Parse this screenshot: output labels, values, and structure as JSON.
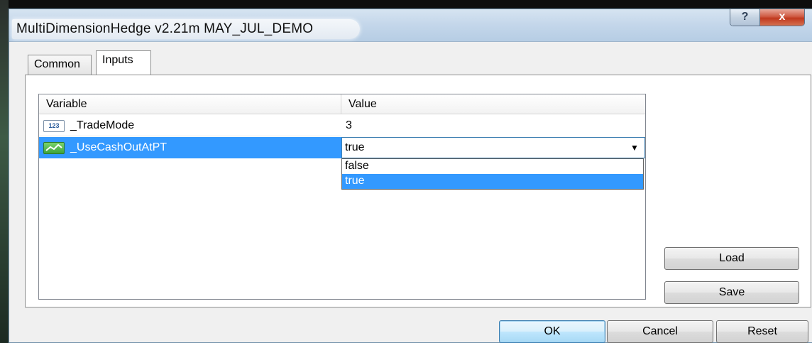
{
  "window": {
    "title": "MultiDimensionHedge v2.21m MAY_JUL_DEMO",
    "help_label": "?",
    "close_label": "x"
  },
  "tabs": [
    {
      "label": "Common",
      "active": false
    },
    {
      "label": "Inputs",
      "active": true
    }
  ],
  "grid": {
    "columns": [
      "Variable",
      "Value"
    ],
    "rows": [
      {
        "icon": "integer-type-icon",
        "icon_text": "123",
        "variable": "_TradeMode",
        "value": "3",
        "selected": false
      },
      {
        "icon": "boolean-type-icon",
        "variable": "_UseCashOutAtPT",
        "value": "true",
        "selected": true
      }
    ],
    "dropdown": {
      "options": [
        "false",
        "true"
      ],
      "selected": "true"
    }
  },
  "buttons": {
    "load": "Load",
    "save": "Save",
    "ok": "OK",
    "cancel": "Cancel",
    "reset": "Reset"
  },
  "colors": {
    "selection": "#3399ff",
    "title_bar": "#c3d6ea",
    "close_button": "#c0391f"
  }
}
